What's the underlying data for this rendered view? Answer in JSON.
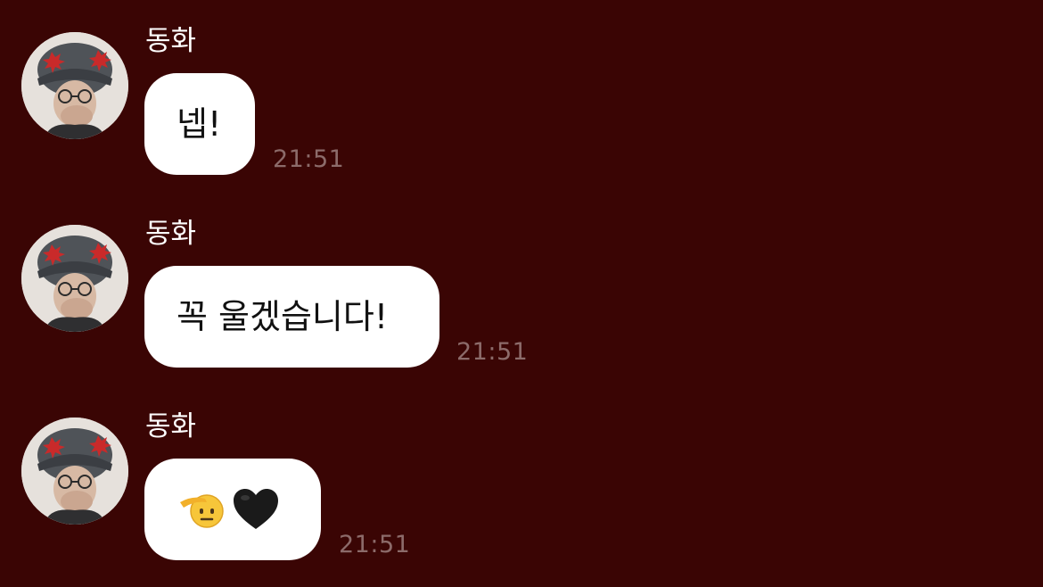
{
  "chat": {
    "messages": [
      {
        "sender": "동화",
        "text": "넵!",
        "time": "21:51"
      },
      {
        "sender": "동화",
        "text": "꼭 울겠습니다!",
        "time": "21:51"
      },
      {
        "sender": "동화",
        "text": "",
        "time": "21:51",
        "emoji": [
          "saluting-face-emoji",
          "black-heart-emoji"
        ]
      }
    ]
  },
  "colors": {
    "background": "#3a0504",
    "bubble": "#ffffff",
    "timestamp": "#8c6b6a",
    "sender": "#ffffff"
  }
}
